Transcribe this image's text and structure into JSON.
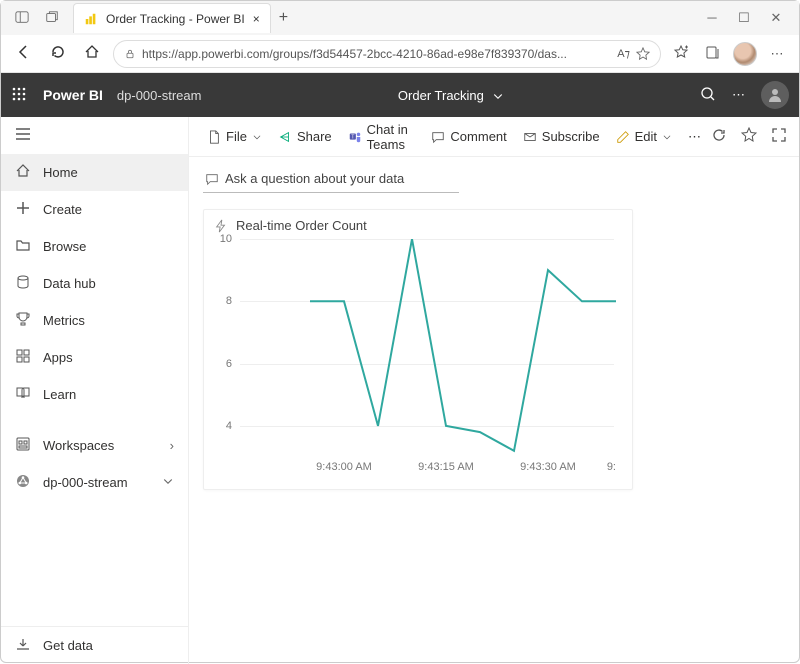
{
  "browser": {
    "tab_title": "Order Tracking - Power BI",
    "url": "https://app.powerbi.com/groups/f3d54457-2bcc-4210-86ad-e98e7f839370/das..."
  },
  "header": {
    "app_title": "Power BI",
    "workspace_name": "dp-000-stream",
    "center_title": "Order Tracking"
  },
  "sidebar": {
    "items": [
      {
        "icon": "home",
        "label": "Home"
      },
      {
        "icon": "plus",
        "label": "Create"
      },
      {
        "icon": "folder",
        "label": "Browse"
      },
      {
        "icon": "datahub",
        "label": "Data hub"
      },
      {
        "icon": "trophy",
        "label": "Metrics"
      },
      {
        "icon": "apps",
        "label": "Apps"
      },
      {
        "icon": "book",
        "label": "Learn"
      }
    ],
    "workspaces_label": "Workspaces",
    "current_workspace": "dp-000-stream",
    "footer_label": "Get data"
  },
  "toolbar": {
    "file_label": "File",
    "share_label": "Share",
    "chat_label": "Chat in Teams",
    "comment_label": "Comment",
    "subscribe_label": "Subscribe",
    "edit_label": "Edit"
  },
  "ask": {
    "placeholder": "Ask a question about your data"
  },
  "chart_data": {
    "type": "line",
    "title": "Real-time Order Count",
    "xlabel": "",
    "ylabel": "",
    "ylim": [
      3,
      10
    ],
    "x": [
      "9:42:55 AM",
      "9:43:00 AM",
      "9:43:05 AM",
      "9:43:10 AM",
      "9:43:15 AM",
      "9:43:20 AM",
      "9:43:25 AM",
      "9:43:30 AM",
      "9:43:35 AM",
      "9:43:40 AM"
    ],
    "values": [
      8.0,
      8.0,
      4.0,
      10.0,
      4.0,
      3.8,
      3.2,
      9.0,
      8.0,
      8.0
    ],
    "x_tick_labels": [
      "9:43:00 AM",
      "9:43:15 AM",
      "9:43:30 AM",
      "9:"
    ],
    "y_tick_labels": [
      "4",
      "6",
      "8",
      "10"
    ]
  }
}
